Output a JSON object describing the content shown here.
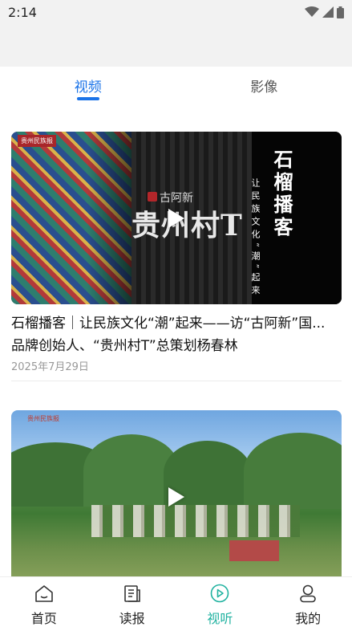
{
  "status_bar": {
    "time": "2:14"
  },
  "tabs": [
    {
      "label": "视频",
      "active": true
    },
    {
      "label": "影像",
      "active": false
    }
  ],
  "feed": [
    {
      "title_line1": "石榴播客｜让民族文化“潮”起来——访“古阿新”国...",
      "title_line2": "品牌创始人、“贵州村T”总策划杨春林",
      "date": "2025年7月29日",
      "thumbnail": {
        "logo": "贵州民族报",
        "calligraphy_main": "贵州村T",
        "calligraphy_sub": "古阿新",
        "vertical_title": "石榴播客",
        "vertical_subtitle": "让民族文化“潮”起来"
      }
    },
    {
      "thumbnail": {
        "logo": "贵州民族报"
      }
    }
  ],
  "bottom_nav": [
    {
      "label": "首页",
      "icon": "home-icon",
      "active": false
    },
    {
      "label": "读报",
      "icon": "newspaper-icon",
      "active": false
    },
    {
      "label": "视听",
      "icon": "play-circle-icon",
      "active": true
    },
    {
      "label": "我的",
      "icon": "user-icon",
      "active": false
    }
  ],
  "colors": {
    "tab_active": "#1a73e8",
    "nav_active": "#20b2a0",
    "header_bg": "#f2f2f2"
  }
}
